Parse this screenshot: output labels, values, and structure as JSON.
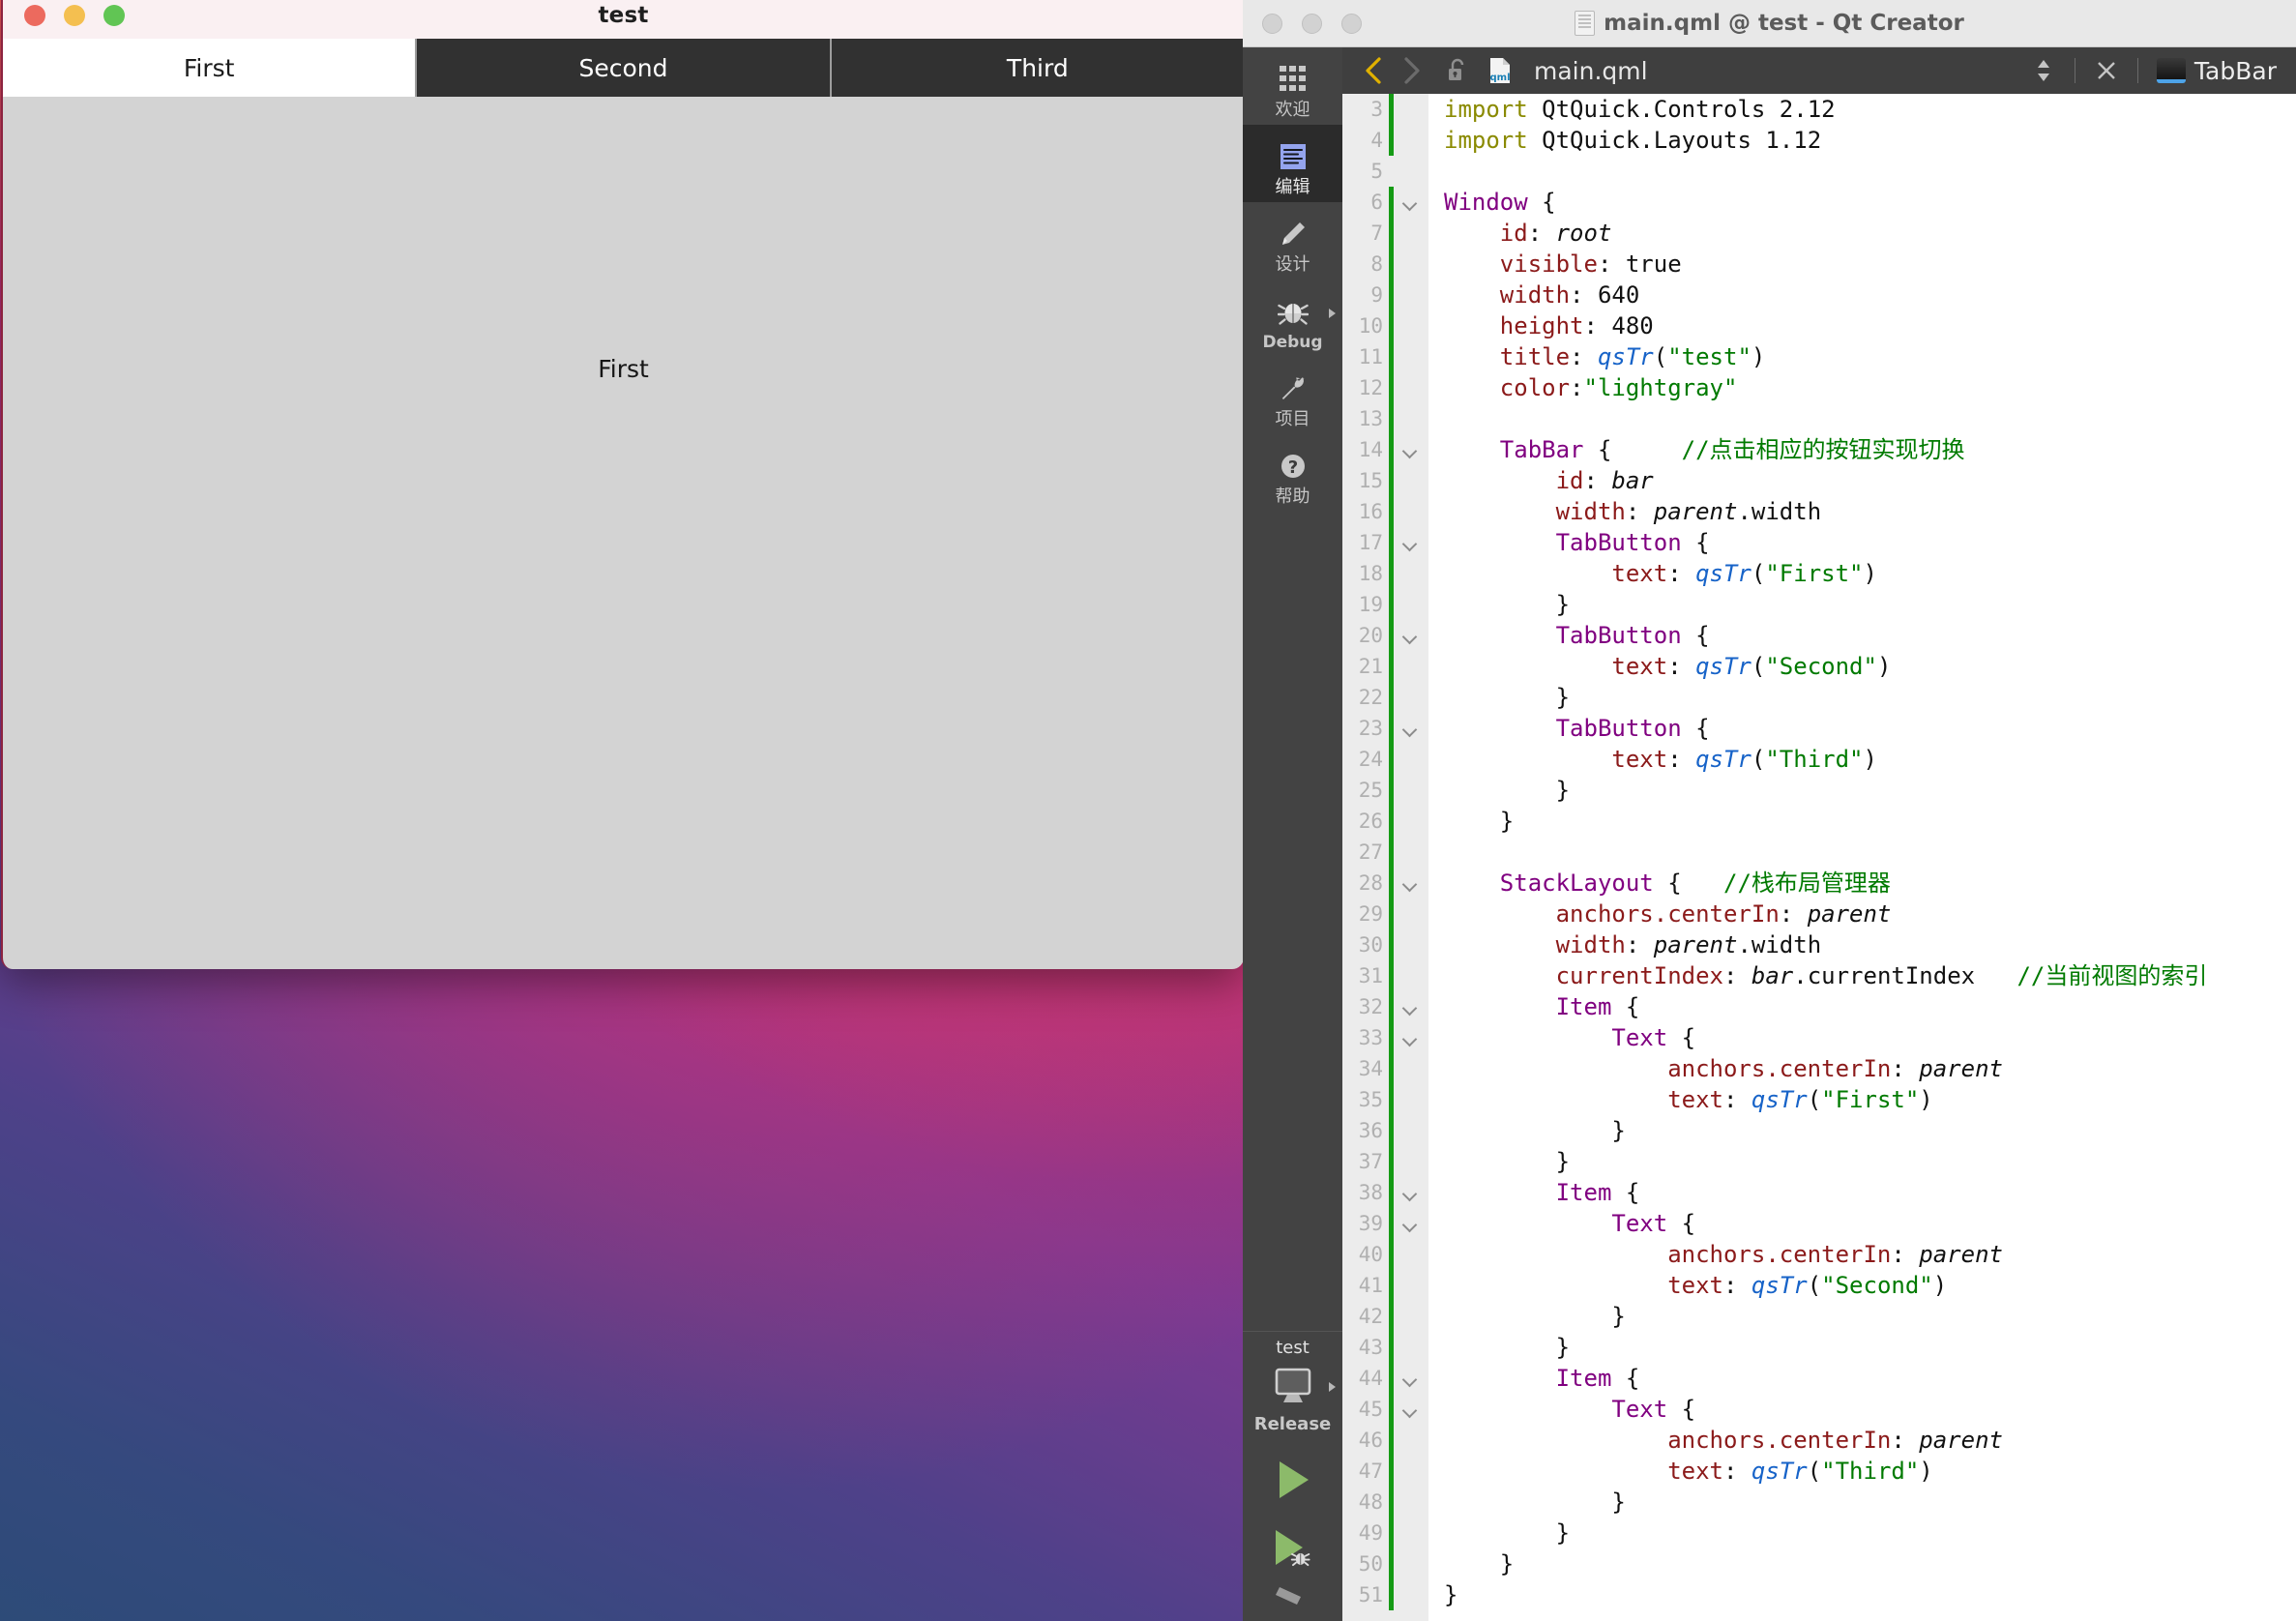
{
  "desktop": {
    "wallpaper_name": "macos-big-sur-gradient"
  },
  "app_window": {
    "title": "test",
    "traffic_lights": [
      {
        "name": "close",
        "color": "#ec6a5e"
      },
      {
        "name": "minimize",
        "color": "#f4bf50"
      },
      {
        "name": "zoom",
        "color": "#61c554"
      }
    ],
    "tabs": [
      {
        "label": "First",
        "active": true
      },
      {
        "label": "Second",
        "active": false
      },
      {
        "label": "Third",
        "active": false
      }
    ],
    "content_text": "First",
    "content_color": "#d3d3d3"
  },
  "creator": {
    "window_title": "main.qml @ test - Qt Creator",
    "title_icon": "document-icon",
    "traffic_lights": [
      "close",
      "minimize",
      "zoom"
    ],
    "modes": [
      {
        "label": "欢迎",
        "icon": "grid-icon",
        "selected": false,
        "has_arrow": false,
        "latin": false
      },
      {
        "label": "编辑",
        "icon": "edit-lines-icon",
        "selected": true,
        "has_arrow": false,
        "latin": false
      },
      {
        "label": "设计",
        "icon": "pencil-icon",
        "selected": false,
        "has_arrow": false,
        "latin": false
      },
      {
        "label": "Debug",
        "icon": "bug-icon",
        "selected": false,
        "has_arrow": true,
        "latin": true
      },
      {
        "label": "项目",
        "icon": "wrench-icon",
        "selected": false,
        "has_arrow": false,
        "latin": false
      },
      {
        "label": "帮助",
        "icon": "question-circle-icon",
        "selected": false,
        "has_arrow": false,
        "latin": false
      }
    ],
    "kit_selector": {
      "project_name": "test",
      "build_config": "Release",
      "icon": "desktop-monitor-icon",
      "has_arrow": true
    },
    "run_buttons": [
      {
        "name": "run-button",
        "icon": "play-triangle-icon",
        "color": "#8cba6a"
      },
      {
        "name": "debug-button",
        "icon": "play-bug-icon",
        "color": "#8cba6a"
      },
      {
        "name": "build-button",
        "icon": "hammer-icon",
        "color": "#9a9a9a"
      }
    ],
    "editor_toolbar": {
      "back_label": "back-arrow",
      "back_enabled": true,
      "forward_label": "forward-arrow",
      "forward_enabled": false,
      "lock_state": "unlocked",
      "file_icon": "qml-file-icon",
      "filename": "main.qml",
      "split_selector": "updown-chevrons",
      "close_label": "×",
      "outline_chip": "TabBar"
    },
    "accent_colors": {
      "keyword": "#800080",
      "property": "#8b1a1a",
      "string": "#007a00",
      "comment": "#007a00",
      "function": "#1763c8",
      "import": "#8a8a00",
      "change_bar": "#159b15"
    },
    "code": [
      {
        "n": 3,
        "fold": false,
        "change": true,
        "tokens": [
          {
            "t": "import",
            "c": "import"
          },
          {
            "t": "plain",
            "c": " QtQuick.Controls 2.12"
          }
        ]
      },
      {
        "n": 4,
        "fold": false,
        "change": true,
        "tokens": [
          {
            "t": "import",
            "c": "import"
          },
          {
            "t": "plain",
            "c": " QtQuick.Layouts 1.12"
          }
        ]
      },
      {
        "n": 5,
        "fold": false,
        "change": false,
        "tokens": []
      },
      {
        "n": 6,
        "fold": true,
        "change": true,
        "tokens": [
          {
            "t": "type",
            "c": "Window"
          },
          {
            "t": "plain",
            "c": " {"
          }
        ]
      },
      {
        "n": 7,
        "fold": false,
        "change": true,
        "tokens": [
          {
            "t": "prop",
            "c": "    id"
          },
          {
            "t": "plain",
            "c": ": "
          },
          {
            "t": "id",
            "c": "root"
          }
        ]
      },
      {
        "n": 8,
        "fold": false,
        "change": true,
        "tokens": [
          {
            "t": "prop",
            "c": "    visible"
          },
          {
            "t": "plain",
            "c": ": true"
          }
        ]
      },
      {
        "n": 9,
        "fold": false,
        "change": true,
        "tokens": [
          {
            "t": "prop",
            "c": "    width"
          },
          {
            "t": "plain",
            "c": ": 640"
          }
        ]
      },
      {
        "n": 10,
        "fold": false,
        "change": true,
        "tokens": [
          {
            "t": "prop",
            "c": "    height"
          },
          {
            "t": "plain",
            "c": ": 480"
          }
        ]
      },
      {
        "n": 11,
        "fold": false,
        "change": true,
        "tokens": [
          {
            "t": "prop",
            "c": "    title"
          },
          {
            "t": "plain",
            "c": ": "
          },
          {
            "t": "func",
            "c": "qsTr"
          },
          {
            "t": "plain",
            "c": "("
          },
          {
            "t": "str",
            "c": "\"test\""
          },
          {
            "t": "plain",
            "c": ")"
          }
        ]
      },
      {
        "n": 12,
        "fold": false,
        "change": true,
        "tokens": [
          {
            "t": "prop",
            "c": "    color"
          },
          {
            "t": "plain",
            "c": ":"
          },
          {
            "t": "str",
            "c": "\"lightgray\""
          }
        ]
      },
      {
        "n": 13,
        "fold": false,
        "change": true,
        "tokens": []
      },
      {
        "n": 14,
        "fold": true,
        "change": true,
        "tokens": [
          {
            "t": "type",
            "c": "    TabBar"
          },
          {
            "t": "plain",
            "c": " {     "
          },
          {
            "t": "cmt",
            "c": "//点击相应的按钮实现切换"
          }
        ]
      },
      {
        "n": 15,
        "fold": false,
        "change": true,
        "tokens": [
          {
            "t": "prop",
            "c": "        id"
          },
          {
            "t": "plain",
            "c": ": "
          },
          {
            "t": "id",
            "c": "bar"
          }
        ]
      },
      {
        "n": 16,
        "fold": false,
        "change": true,
        "tokens": [
          {
            "t": "prop",
            "c": "        width"
          },
          {
            "t": "plain",
            "c": ": "
          },
          {
            "t": "id",
            "c": "parent"
          },
          {
            "t": "plain",
            "c": ".width"
          }
        ]
      },
      {
        "n": 17,
        "fold": true,
        "change": true,
        "tokens": [
          {
            "t": "type",
            "c": "        TabButton"
          },
          {
            "t": "plain",
            "c": " {"
          }
        ]
      },
      {
        "n": 18,
        "fold": false,
        "change": true,
        "tokens": [
          {
            "t": "prop",
            "c": "            text"
          },
          {
            "t": "plain",
            "c": ": "
          },
          {
            "t": "func",
            "c": "qsTr"
          },
          {
            "t": "plain",
            "c": "("
          },
          {
            "t": "str",
            "c": "\"First\""
          },
          {
            "t": "plain",
            "c": ")"
          }
        ]
      },
      {
        "n": 19,
        "fold": false,
        "change": true,
        "tokens": [
          {
            "t": "plain",
            "c": "        }"
          }
        ]
      },
      {
        "n": 20,
        "fold": true,
        "change": true,
        "tokens": [
          {
            "t": "type",
            "c": "        TabButton"
          },
          {
            "t": "plain",
            "c": " {"
          }
        ]
      },
      {
        "n": 21,
        "fold": false,
        "change": true,
        "tokens": [
          {
            "t": "prop",
            "c": "            text"
          },
          {
            "t": "plain",
            "c": ": "
          },
          {
            "t": "func",
            "c": "qsTr"
          },
          {
            "t": "plain",
            "c": "("
          },
          {
            "t": "str",
            "c": "\"Second\""
          },
          {
            "t": "plain",
            "c": ")"
          }
        ]
      },
      {
        "n": 22,
        "fold": false,
        "change": true,
        "tokens": [
          {
            "t": "plain",
            "c": "        }"
          }
        ]
      },
      {
        "n": 23,
        "fold": true,
        "change": true,
        "tokens": [
          {
            "t": "type",
            "c": "        TabButton"
          },
          {
            "t": "plain",
            "c": " {"
          }
        ]
      },
      {
        "n": 24,
        "fold": false,
        "change": true,
        "tokens": [
          {
            "t": "prop",
            "c": "            text"
          },
          {
            "t": "plain",
            "c": ": "
          },
          {
            "t": "func",
            "c": "qsTr"
          },
          {
            "t": "plain",
            "c": "("
          },
          {
            "t": "str",
            "c": "\"Third\""
          },
          {
            "t": "plain",
            "c": ")"
          }
        ]
      },
      {
        "n": 25,
        "fold": false,
        "change": true,
        "tokens": [
          {
            "t": "plain",
            "c": "        }"
          }
        ]
      },
      {
        "n": 26,
        "fold": false,
        "change": true,
        "tokens": [
          {
            "t": "plain",
            "c": "    }"
          }
        ]
      },
      {
        "n": 27,
        "fold": false,
        "change": true,
        "tokens": []
      },
      {
        "n": 28,
        "fold": true,
        "change": true,
        "tokens": [
          {
            "t": "type",
            "c": "    StackLayout"
          },
          {
            "t": "plain",
            "c": " {   "
          },
          {
            "t": "cmt",
            "c": "//栈布局管理器"
          }
        ]
      },
      {
        "n": 29,
        "fold": false,
        "change": true,
        "tokens": [
          {
            "t": "prop",
            "c": "        anchors.centerIn"
          },
          {
            "t": "plain",
            "c": ": "
          },
          {
            "t": "id",
            "c": "parent"
          }
        ]
      },
      {
        "n": 30,
        "fold": false,
        "change": true,
        "tokens": [
          {
            "t": "prop",
            "c": "        width"
          },
          {
            "t": "plain",
            "c": ": "
          },
          {
            "t": "id",
            "c": "parent"
          },
          {
            "t": "plain",
            "c": ".width"
          }
        ]
      },
      {
        "n": 31,
        "fold": false,
        "change": true,
        "tokens": [
          {
            "t": "prop",
            "c": "        currentIndex"
          },
          {
            "t": "plain",
            "c": ": "
          },
          {
            "t": "id",
            "c": "bar"
          },
          {
            "t": "plain",
            "c": ".currentIndex   "
          },
          {
            "t": "cmt",
            "c": "//当前视图的索引"
          }
        ]
      },
      {
        "n": 32,
        "fold": true,
        "change": true,
        "tokens": [
          {
            "t": "type",
            "c": "        Item"
          },
          {
            "t": "plain",
            "c": " {"
          }
        ]
      },
      {
        "n": 33,
        "fold": true,
        "change": true,
        "tokens": [
          {
            "t": "type",
            "c": "            Text"
          },
          {
            "t": "plain",
            "c": " {"
          }
        ]
      },
      {
        "n": 34,
        "fold": false,
        "change": true,
        "tokens": [
          {
            "t": "prop",
            "c": "                anchors.centerIn"
          },
          {
            "t": "plain",
            "c": ": "
          },
          {
            "t": "id",
            "c": "parent"
          }
        ]
      },
      {
        "n": 35,
        "fold": false,
        "change": true,
        "tokens": [
          {
            "t": "prop",
            "c": "                text"
          },
          {
            "t": "plain",
            "c": ": "
          },
          {
            "t": "func",
            "c": "qsTr"
          },
          {
            "t": "plain",
            "c": "("
          },
          {
            "t": "str",
            "c": "\"First\""
          },
          {
            "t": "plain",
            "c": ")"
          }
        ]
      },
      {
        "n": 36,
        "fold": false,
        "change": true,
        "tokens": [
          {
            "t": "plain",
            "c": "            }"
          }
        ]
      },
      {
        "n": 37,
        "fold": false,
        "change": true,
        "tokens": [
          {
            "t": "plain",
            "c": "        }"
          }
        ]
      },
      {
        "n": 38,
        "fold": true,
        "change": true,
        "tokens": [
          {
            "t": "type",
            "c": "        Item"
          },
          {
            "t": "plain",
            "c": " {"
          }
        ]
      },
      {
        "n": 39,
        "fold": true,
        "change": true,
        "tokens": [
          {
            "t": "type",
            "c": "            Text"
          },
          {
            "t": "plain",
            "c": " {"
          }
        ]
      },
      {
        "n": 40,
        "fold": false,
        "change": true,
        "tokens": [
          {
            "t": "prop",
            "c": "                anchors.centerIn"
          },
          {
            "t": "plain",
            "c": ": "
          },
          {
            "t": "id",
            "c": "parent"
          }
        ]
      },
      {
        "n": 41,
        "fold": false,
        "change": true,
        "tokens": [
          {
            "t": "prop",
            "c": "                text"
          },
          {
            "t": "plain",
            "c": ": "
          },
          {
            "t": "func",
            "c": "qsTr"
          },
          {
            "t": "plain",
            "c": "("
          },
          {
            "t": "str",
            "c": "\"Second\""
          },
          {
            "t": "plain",
            "c": ")"
          }
        ]
      },
      {
        "n": 42,
        "fold": false,
        "change": true,
        "tokens": [
          {
            "t": "plain",
            "c": "            }"
          }
        ]
      },
      {
        "n": 43,
        "fold": false,
        "change": true,
        "tokens": [
          {
            "t": "plain",
            "c": "        }"
          }
        ]
      },
      {
        "n": 44,
        "fold": true,
        "change": true,
        "tokens": [
          {
            "t": "type",
            "c": "        Item"
          },
          {
            "t": "plain",
            "c": " {"
          }
        ]
      },
      {
        "n": 45,
        "fold": true,
        "change": true,
        "tokens": [
          {
            "t": "type",
            "c": "            Text"
          },
          {
            "t": "plain",
            "c": " {"
          }
        ]
      },
      {
        "n": 46,
        "fold": false,
        "change": true,
        "tokens": [
          {
            "t": "prop",
            "c": "                anchors.centerIn"
          },
          {
            "t": "plain",
            "c": ": "
          },
          {
            "t": "id",
            "c": "parent"
          }
        ]
      },
      {
        "n": 47,
        "fold": false,
        "change": true,
        "tokens": [
          {
            "t": "prop",
            "c": "                text"
          },
          {
            "t": "plain",
            "c": ": "
          },
          {
            "t": "func",
            "c": "qsTr"
          },
          {
            "t": "plain",
            "c": "("
          },
          {
            "t": "str",
            "c": "\"Third\""
          },
          {
            "t": "plain",
            "c": ")"
          }
        ]
      },
      {
        "n": 48,
        "fold": false,
        "change": true,
        "tokens": [
          {
            "t": "plain",
            "c": "            }"
          }
        ]
      },
      {
        "n": 49,
        "fold": false,
        "change": true,
        "tokens": [
          {
            "t": "plain",
            "c": "        }"
          }
        ]
      },
      {
        "n": 50,
        "fold": false,
        "change": true,
        "tokens": [
          {
            "t": "plain",
            "c": "    }"
          }
        ]
      },
      {
        "n": 51,
        "fold": false,
        "change": true,
        "tokens": [
          {
            "t": "plain",
            "c": "}"
          }
        ]
      }
    ]
  }
}
